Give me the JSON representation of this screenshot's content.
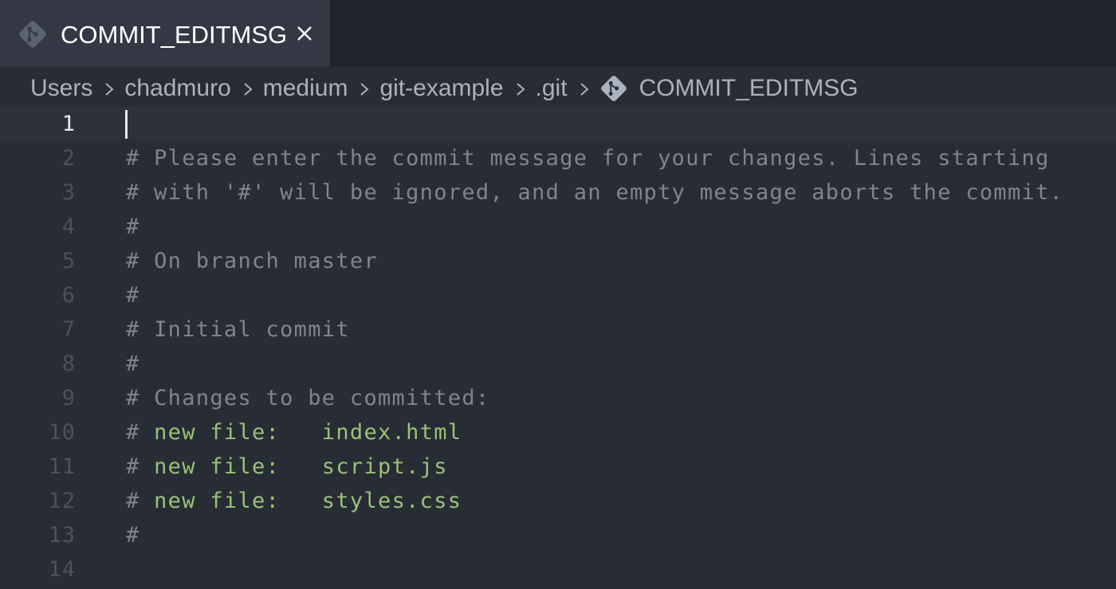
{
  "tab": {
    "label": "COMMIT_EDITMSG",
    "icon": "git-icon",
    "close_icon": "close-icon"
  },
  "breadcrumb": {
    "items": [
      "Users",
      "chadmuro",
      "medium",
      "git-example",
      ".git"
    ],
    "file": "COMMIT_EDITMSG"
  },
  "editor": {
    "active_line": 1,
    "lines": [
      {
        "n": "1",
        "text": ""
      },
      {
        "n": "2",
        "text": "# Please enter the commit message for your changes. Lines starting"
      },
      {
        "n": "3",
        "text": "# with '#' will be ignored, and an empty message aborts the commit."
      },
      {
        "n": "4",
        "text": "#"
      },
      {
        "n": "5",
        "text": "# On branch master"
      },
      {
        "n": "6",
        "text": "#"
      },
      {
        "n": "7",
        "text": "# Initial commit"
      },
      {
        "n": "8",
        "text": "#"
      },
      {
        "n": "9",
        "text": "# Changes to be committed:"
      },
      {
        "n": "10",
        "text": "# ",
        "kw": "new file:   index.html"
      },
      {
        "n": "11",
        "text": "# ",
        "kw": "new file:   script.js"
      },
      {
        "n": "12",
        "text": "# ",
        "kw": "new file:   styles.css"
      },
      {
        "n": "13",
        "text": "#"
      },
      {
        "n": "14",
        "text": ""
      }
    ]
  },
  "colors": {
    "background": "#282c34",
    "tab_bg": "#333844",
    "comment": "#7f848e",
    "keyword_green": "#98c379",
    "line_number": "#495162"
  }
}
